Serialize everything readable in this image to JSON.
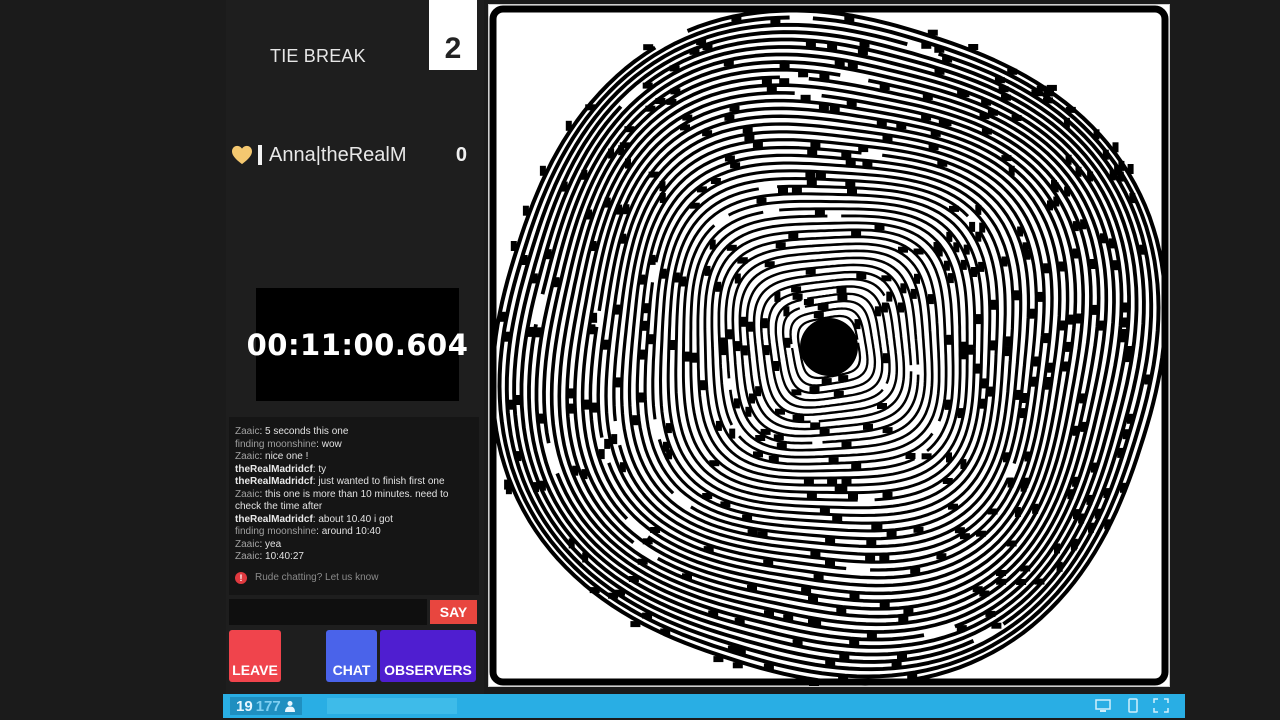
{
  "game": {
    "mode_label": "TIE BREAK",
    "round_number": "2"
  },
  "player": {
    "name": "Anna|theRealM",
    "score": "0",
    "icon": "heart-icon"
  },
  "timer": {
    "value": "00:11:00.604"
  },
  "chat": {
    "messages": [
      {
        "user": "Zaaic",
        "text": "5 seconds this one",
        "strong": false
      },
      {
        "user": "finding moonshine",
        "text": "wow",
        "strong": false
      },
      {
        "user": "Zaaic",
        "text": "nice one !",
        "strong": false
      },
      {
        "user": "theRealMadridcf",
        "text": "ty",
        "strong": true
      },
      {
        "user": "theRealMadridcf",
        "text": "just wanted to finish first one",
        "strong": true
      },
      {
        "user": "Zaaic",
        "text": "this one is more than 10 minutes. need to check the time after",
        "strong": false
      },
      {
        "user": "theRealMadridcf",
        "text": "about 10.40 i got",
        "strong": true
      },
      {
        "user": "finding moonshine",
        "text": "around 10:40",
        "strong": false
      },
      {
        "user": "Zaaic",
        "text": "yea",
        "strong": false
      },
      {
        "user": "Zaaic",
        "text": "10:40:27",
        "strong": false
      }
    ],
    "rude_notice": "Rude chatting? Let us know",
    "input_value": "",
    "say_label": "SAY"
  },
  "buttons": {
    "leave_label": "LEAVE",
    "chat_label": "CHAT",
    "observers_label": "OBSERVERS"
  },
  "status_bar": {
    "count_bright": "19",
    "count_dim": "177"
  },
  "colors": {
    "leave": "#f0444c",
    "chat": "#4a63ea",
    "observers": "#4f1ed0",
    "say": "#e8463f",
    "status_bar": "#29aee4"
  }
}
